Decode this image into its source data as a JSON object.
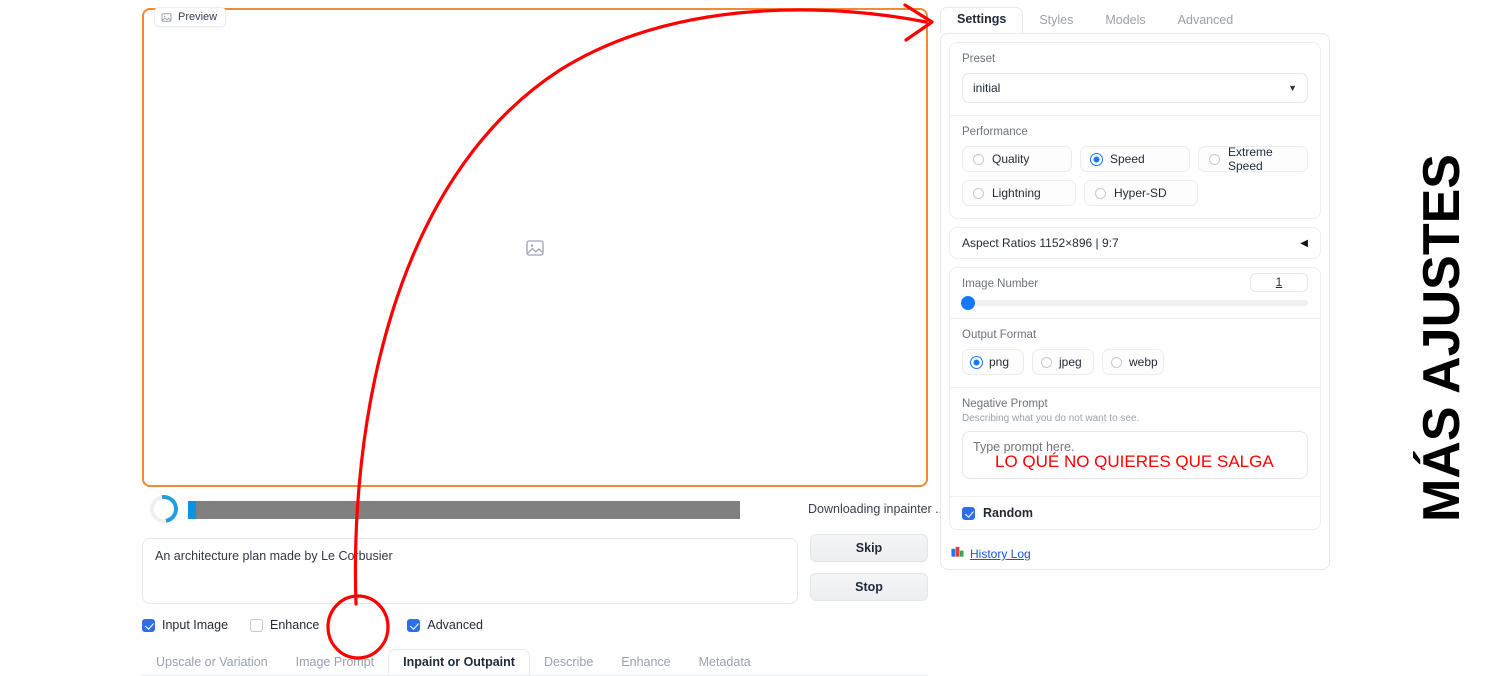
{
  "preview": {
    "badge_label": "Preview",
    "badge_icon": "image-icon",
    "placeholder_icon": "image-placeholder-icon",
    "border_color": "#f08a34"
  },
  "progress": {
    "status_text": "Downloading inpainter ...",
    "fill_percent": 1.5,
    "track_color": "#808080",
    "fill_color": "#0b93e3",
    "spinner_icon": "loading-spinner-icon"
  },
  "prompt": {
    "value": "An architecture plan made by Le Corbusier",
    "placeholder": "Type prompt here."
  },
  "actions": {
    "skip_label": "Skip",
    "stop_label": "Stop"
  },
  "checkboxes": [
    {
      "label": "Input Image",
      "checked": true
    },
    {
      "label": "Enhance",
      "checked": false
    },
    {
      "label": "Advanced",
      "checked": true
    }
  ],
  "bottom_tabs": [
    {
      "label": "Upscale or Variation",
      "active": false
    },
    {
      "label": "Image Prompt",
      "active": false
    },
    {
      "label": "Inpaint or Outpaint",
      "active": true
    },
    {
      "label": "Describe",
      "active": false
    },
    {
      "label": "Enhance",
      "active": false
    },
    {
      "label": "Metadata",
      "active": false
    }
  ],
  "panel": {
    "tabs": [
      {
        "label": "Settings",
        "active": true
      },
      {
        "label": "Styles",
        "active": false
      },
      {
        "label": "Models",
        "active": false
      },
      {
        "label": "Advanced",
        "active": false
      }
    ],
    "preset": {
      "label": "Preset",
      "value": "initial",
      "caret_icon": "chevron-down-icon"
    },
    "performance": {
      "label": "Performance",
      "options": [
        {
          "label": "Quality",
          "selected": false
        },
        {
          "label": "Speed",
          "selected": true
        },
        {
          "label": "Extreme Speed",
          "selected": false
        },
        {
          "label": "Lightning",
          "selected": false
        },
        {
          "label": "Hyper-SD",
          "selected": false
        }
      ]
    },
    "aspect_ratios": {
      "label": "Aspect Ratios 1152×896 | 9:7",
      "caret_icon": "chevron-left-icon"
    },
    "image_number": {
      "label": "Image Number",
      "value": "1",
      "slider_percent": 0
    },
    "output_format": {
      "label": "Output Format",
      "options": [
        {
          "label": "png",
          "selected": true
        },
        {
          "label": "jpeg",
          "selected": false
        },
        {
          "label": "webp",
          "selected": false
        }
      ]
    },
    "negative_prompt": {
      "label": "Negative Prompt",
      "description": "Describing what you do not want to see.",
      "placeholder": "Type prompt here.",
      "value": ""
    },
    "random": {
      "label": "Random",
      "checked": true
    },
    "history_log": {
      "label": "History Log",
      "icon": "chart-icon"
    }
  },
  "annotations": {
    "vertical_text": "MÁS AJUSTES",
    "overlay_text": "LO QUÉ NO QUIERES QUE SALGA",
    "accent_color": "#ff0000",
    "arrow_description": "red-curved-arrow-from-advanced-to-settings-tab",
    "circle_description": "red-circle-around-advanced-checkbox"
  }
}
